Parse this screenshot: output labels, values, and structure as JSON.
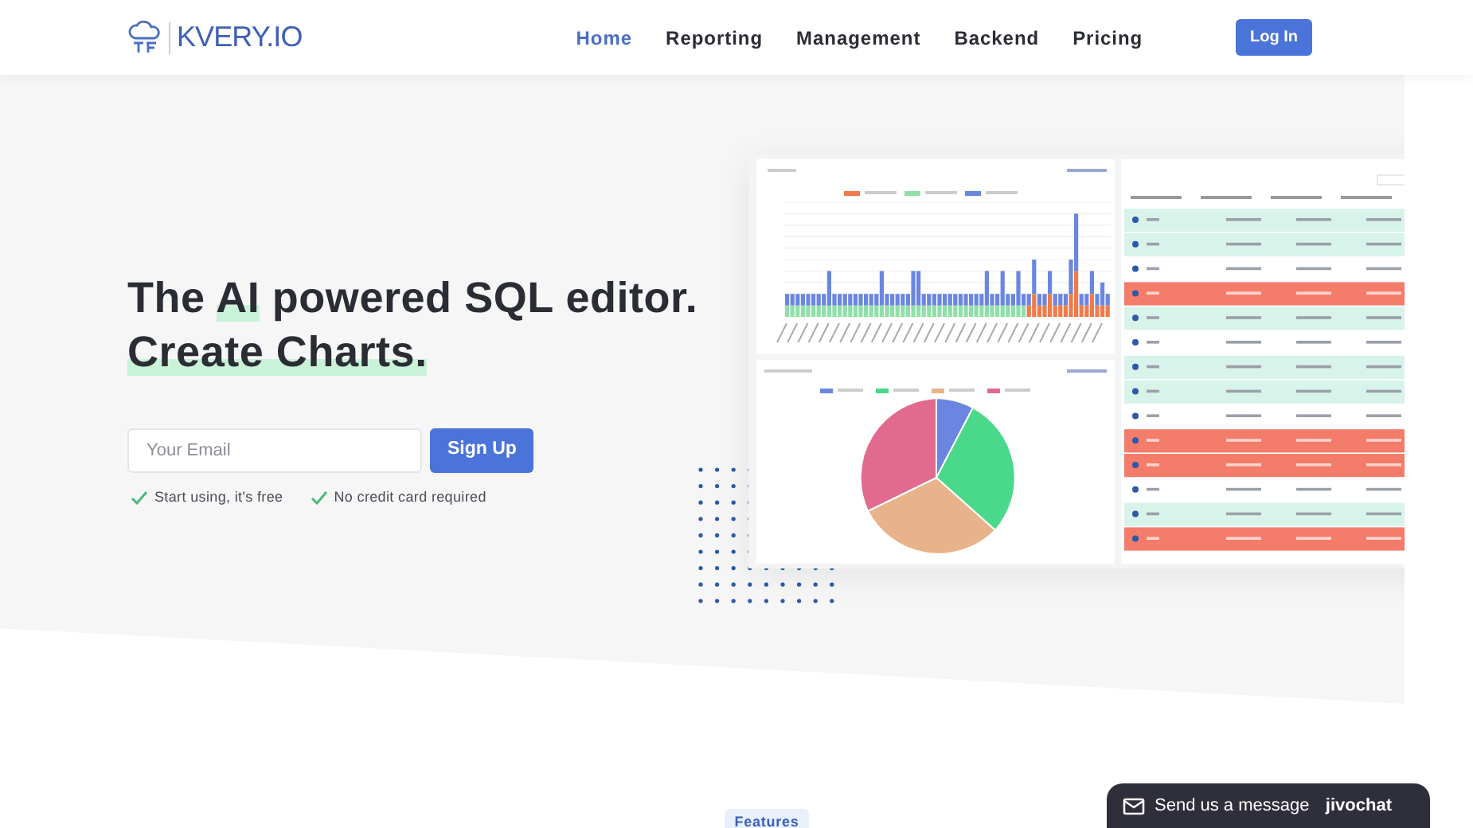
{
  "logo": {
    "text": "KVERY.IO"
  },
  "nav": [
    {
      "label": "Home",
      "selected": true
    },
    {
      "label": "Reporting",
      "selected": false
    },
    {
      "label": "Management",
      "selected": false
    },
    {
      "label": "Backend",
      "selected": false
    },
    {
      "label": "Pricing",
      "selected": false
    }
  ],
  "login_button": "Log In",
  "headline": [
    [
      {
        "text": "The ",
        "highlight": false
      },
      {
        "text": "AI",
        "highlight": true
      },
      {
        "text": " powered SQL editor.",
        "highlight": false
      }
    ],
    [
      {
        "text": "Create Charts.",
        "highlight": true
      }
    ]
  ],
  "signup": {
    "placeholder": "Your Email",
    "button": "Sign Up"
  },
  "perks": [
    "Start using, it's free",
    "No credit card required"
  ],
  "features_badge": "Features",
  "chat_widget": {
    "message": "Send us a message",
    "brand": "jivochat"
  }
}
